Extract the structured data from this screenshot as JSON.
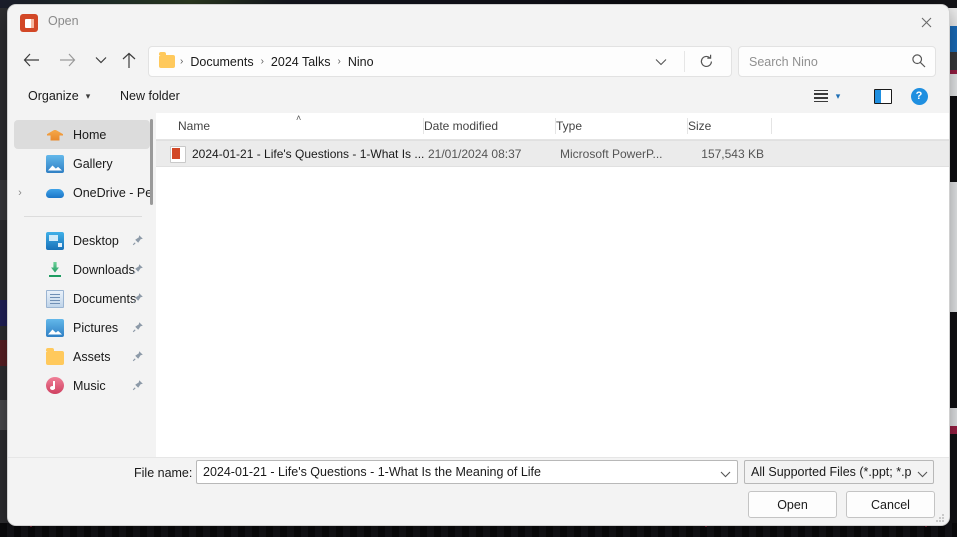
{
  "window": {
    "title": "Open",
    "app_icon": "powerpoint-icon",
    "close_label": "✕"
  },
  "nav": {
    "back_icon": "arrow-left-icon",
    "forward_icon": "arrow-right-icon",
    "recent_icon": "chevron-down-icon",
    "up_icon": "arrow-up-icon",
    "refresh_icon": "refresh-icon",
    "address_chevron": "chevron-down-icon",
    "breadcrumbs": [
      "Documents",
      "2024 Talks",
      "Nino"
    ],
    "separator": "›"
  },
  "search": {
    "placeholder": "Search Nino",
    "icon": "search-icon"
  },
  "commandbar": {
    "organize": "Organize",
    "organize_caret": "▾",
    "new_folder": "New folder",
    "view_icon": "list-view-icon",
    "view_caret": "▾",
    "preview_pane_icon": "preview-pane-icon",
    "help_icon": "help-icon",
    "help_glyph": "?"
  },
  "sidebar": {
    "items": [
      {
        "label": "Home",
        "icon": "home-icon",
        "selected": true,
        "pinned": false,
        "expandable": false
      },
      {
        "label": "Gallery",
        "icon": "gallery-icon",
        "selected": false,
        "pinned": false,
        "expandable": false
      },
      {
        "label": "OneDrive - Pers",
        "icon": "onedrive-icon",
        "selected": false,
        "pinned": false,
        "expandable": true
      }
    ],
    "pinned_items": [
      {
        "label": "Desktop",
        "icon": "desktop-icon",
        "pinned": true
      },
      {
        "label": "Downloads",
        "icon": "downloads-icon",
        "pinned": true
      },
      {
        "label": "Documents",
        "icon": "documents-icon",
        "pinned": true
      },
      {
        "label": "Pictures",
        "icon": "pictures-icon",
        "pinned": true
      },
      {
        "label": "Assets",
        "icon": "folder-icon",
        "pinned": true
      },
      {
        "label": "Music",
        "icon": "music-icon",
        "pinned": true
      }
    ],
    "expand_chevron": "›",
    "pin_icon": "pin-icon"
  },
  "filelist": {
    "columns": [
      "Name",
      "Date modified",
      "Type",
      "Size"
    ],
    "sort_indicator": "˄",
    "rows": [
      {
        "name": "2024-01-21 - Life's Questions - 1-What Is ...",
        "date_modified": "21/01/2024 08:37",
        "type": "Microsoft PowerP...",
        "size": "157,543 KB",
        "icon": "powerpoint-file-icon",
        "selected": true
      }
    ]
  },
  "footer": {
    "filename_label": "File name:",
    "filename_value": "2024-01-21 - Life's Questions - 1-What Is the Meaning of Life",
    "filename_chevron": "chevron-down-icon",
    "filter_value": "All Supported Files (*.ppt; *.ppt",
    "filter_chevron": "chevron-down-icon",
    "open_button": "Open",
    "cancel_button": "Cancel",
    "resize_grip": "resize-grip"
  },
  "colors": {
    "accent": "#1f8fe0",
    "powerpoint": "#d24726",
    "selection": "#ebebeb",
    "chrome": "#f3f3f3"
  }
}
